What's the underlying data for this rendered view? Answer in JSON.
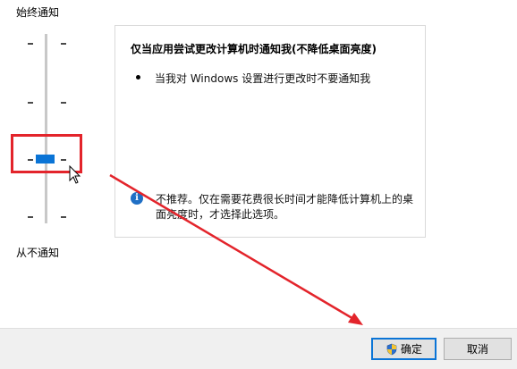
{
  "labels": {
    "top": "始终通知",
    "bottom": "从不通知"
  },
  "slider": {
    "level": 3,
    "max_level": 4
  },
  "panel": {
    "title": "仅当应用尝试更改计算机时通知我(不降低桌面亮度)",
    "bullet": "当我对 Windows 设置进行更改时不要通知我",
    "info": "不推荐。仅在需要花费很长时间才能降低计算机上的桌面亮度时，才选择此选项。"
  },
  "buttons": {
    "ok": "确定",
    "cancel": "取消"
  },
  "colors": {
    "accent": "#0a74d6",
    "annotation": "#e3242b"
  },
  "icons": {
    "info": "info-icon",
    "shield": "uac-shield-icon",
    "cursor": "mouse-cursor-icon"
  }
}
